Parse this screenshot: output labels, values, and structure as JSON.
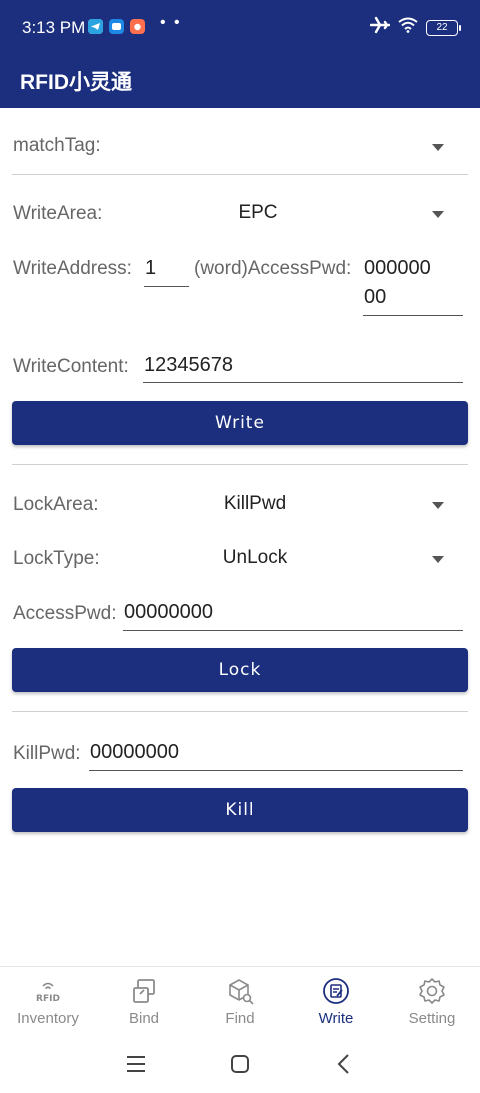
{
  "status_bar": {
    "time": "3:13 PM",
    "dots": "• •",
    "battery": "22"
  },
  "app_bar": {
    "title": "RFID小灵通"
  },
  "match_tag": {
    "label": "matchTag:"
  },
  "write": {
    "area_label": "WriteArea:",
    "area_value": "EPC",
    "address_label": "WriteAddress:",
    "address_value": "1",
    "word_label": "(word)AccessPwd:",
    "access_pwd_line1": "000000",
    "access_pwd_line2": "00",
    "content_label": "WriteContent:",
    "content_value": "12345678",
    "button_label": "Write"
  },
  "lock": {
    "area_label": "LockArea:",
    "area_value": "KillPwd",
    "type_label": "LockType:",
    "type_value": "UnLock",
    "access_pwd_label": "AccessPwd:",
    "access_pwd_value": "00000000",
    "button_label": "Lock"
  },
  "kill": {
    "pwd_label": "KillPwd:",
    "pwd_value": "00000000",
    "button_label": "Kill"
  },
  "bottom_nav": {
    "items": [
      {
        "label": "Inventory",
        "icon": "rfid-icon",
        "icon_text": "RFID"
      },
      {
        "label": "Bind",
        "icon": "bind-icon"
      },
      {
        "label": "Find",
        "icon": "find-icon"
      },
      {
        "label": "Write",
        "icon": "write-icon",
        "active": true
      },
      {
        "label": "Setting",
        "icon": "gear-icon"
      }
    ]
  },
  "colors": {
    "primary": "#1b2f7e",
    "inactive": "#8a8a8a"
  }
}
